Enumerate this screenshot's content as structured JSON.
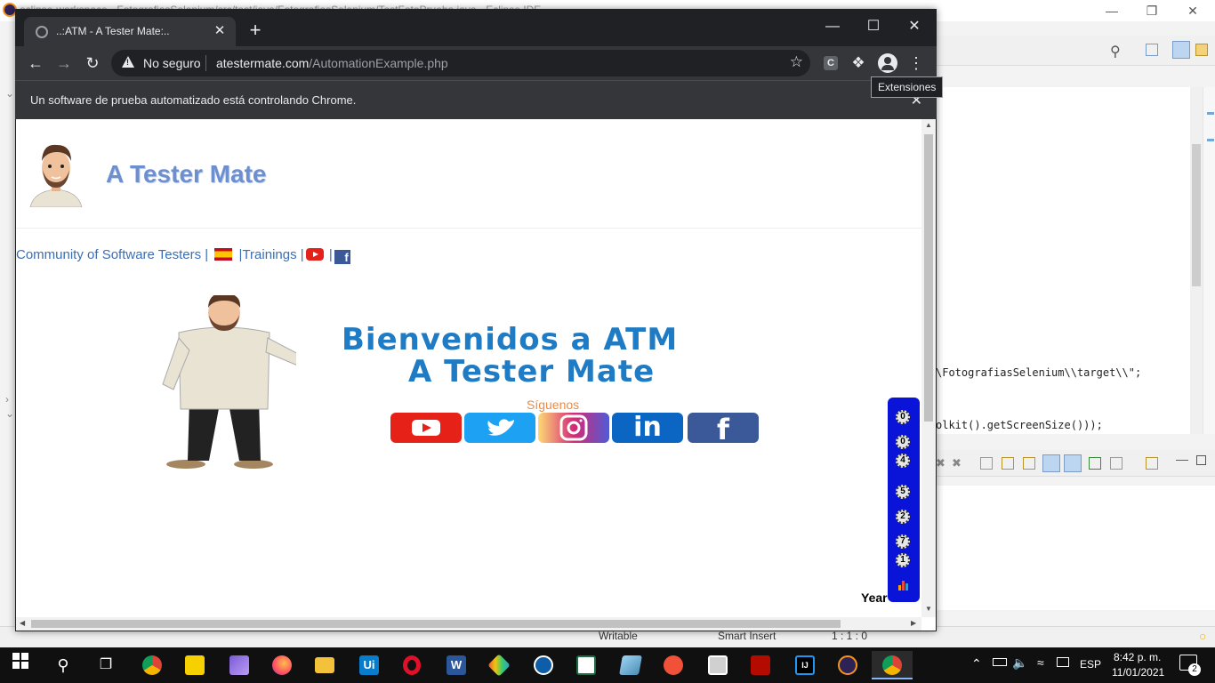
{
  "ide": {
    "title": "eclipse-workspace - FotografiasSelenium/src/test/java/FotografiasSelenium/TestFotoPrueba.java - Eclipse IDE",
    "code_lines": [
      "\\FotografiasSelenium\\\\target\\\\\";",
      "olkit().getScreenSize()));"
    ],
    "status": {
      "writable": "Writable",
      "insert": "Smart Insert",
      "position": "1 : 1 : 0"
    }
  },
  "browser": {
    "tab_title": "..:ATM - A Tester Mate:..",
    "security_label": "No seguro",
    "url_host": "atestermate.com",
    "url_path": "/AutomationExample.php",
    "extension_badge": "C",
    "tooltip": "Extensiones",
    "infobar_message": "Un software de prueba automatizado está controlando Chrome."
  },
  "page": {
    "brand": "A Tester Mate",
    "nav": {
      "community": "Community of Software Testers",
      "sep1": " | ",
      "sep2": " |",
      "trainings": "Trainings",
      "sep3": " |",
      "sep4": " |"
    },
    "welcome_line1": "Bienvenidos a ATM",
    "welcome_line2": "A Tester Mate",
    "follow_us": "Síguenos",
    "counter_digits": [
      "0",
      "0",
      "4",
      "5",
      "2",
      "7",
      "1"
    ],
    "year_label": "Year"
  },
  "taskbar": {
    "language": "ESP",
    "time": "8:42 p. m.",
    "date": "11/01/2021",
    "notifications": "2",
    "word_label": "W",
    "intellij_label": "IJ",
    "uipath_label": "Ui"
  }
}
